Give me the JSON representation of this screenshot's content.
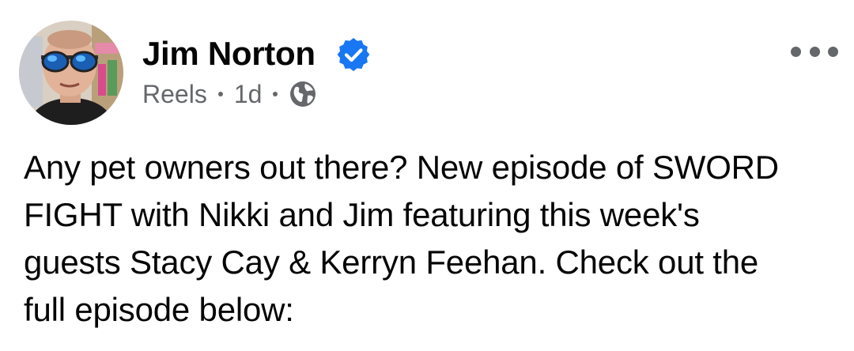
{
  "post": {
    "author": {
      "name": "Jim Norton",
      "verified": true,
      "avatar_icon": "profile-photo-man-with-blue-sunglasses"
    },
    "meta": {
      "source": "Reels",
      "time": "1d",
      "audience_icon": "globe-icon"
    },
    "more_icon": "more-horizontal-icon",
    "text": "Any pet owners out there? New episode of SWORD\nFIGHT with Nikki and Jim featuring this week's\nguests Stacy Cay & Kerryn Feehan. Check out the\nfull episode below:",
    "colors": {
      "verified_badge": "#1877f2",
      "secondary_text": "#65676b",
      "primary_text": "#050505",
      "background": "#ffffff"
    }
  }
}
